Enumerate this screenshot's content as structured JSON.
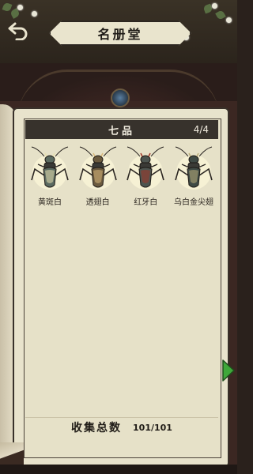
{
  "header": {
    "title": "名册堂",
    "back_icon": "back-arrow-icon"
  },
  "category": {
    "title": "七品",
    "count": "4/4"
  },
  "crickets": [
    {
      "name": "黄斑白",
      "body_color": "#5b6a60",
      "accent": "#e7e0b0"
    },
    {
      "name": "透翅白",
      "body_color": "#6b5a3e",
      "accent": "#d9b87a"
    },
    {
      "name": "红牙白",
      "body_color": "#4d5550",
      "accent": "#a03628"
    },
    {
      "name": "乌白金尖翅",
      "body_color": "#3f4a45",
      "accent": "#b9ad7a"
    }
  ],
  "footer": {
    "label": "收集总数",
    "value": "101/101"
  },
  "next_icon": "next-page-arrow-icon",
  "colors": {
    "page": "#e8e3cc",
    "header_bar": "#37322c",
    "next_arrow": "#3fa83a"
  }
}
